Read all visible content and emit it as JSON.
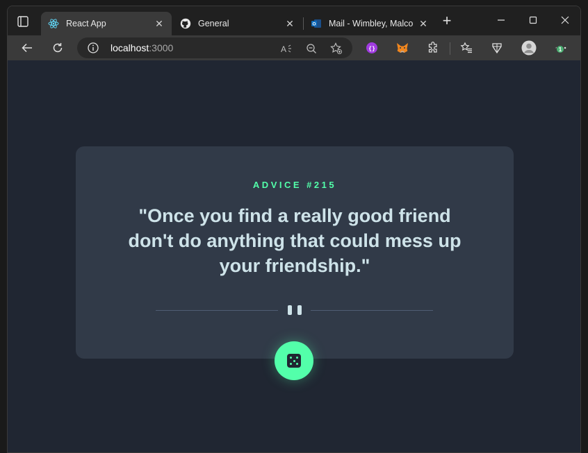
{
  "tabs": [
    {
      "title": "React App",
      "icon": "react-icon",
      "active": true
    },
    {
      "title": "General",
      "icon": "github-icon",
      "active": false
    },
    {
      "title": "Mail - Wimbley, Malcolm",
      "icon": "outlook-icon",
      "active": false
    }
  ],
  "address_bar": {
    "host": "localhost",
    "port": ":3000"
  },
  "notification_badge": "1",
  "advice": {
    "label": "ADVICE #215",
    "quote": "\"Once you find a really good friend don't do anything that could mess up your friendship.\""
  },
  "colors": {
    "page_bg": "#202632",
    "card_bg": "#313a48",
    "accent": "#53ffaa",
    "quote_text": "#cee3e9",
    "divider": "#4f5d74"
  }
}
